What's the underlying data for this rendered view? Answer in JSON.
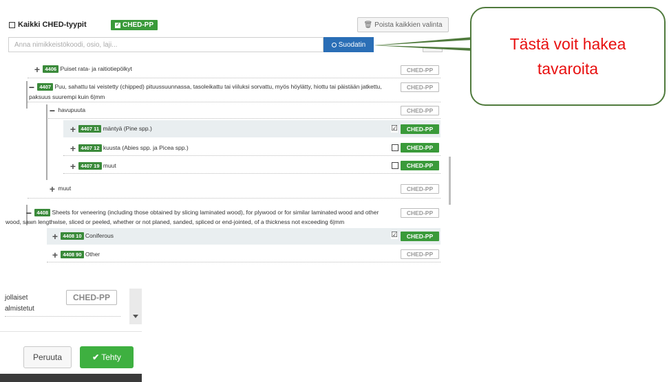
{
  "toolbar": {
    "all_types_label": "Kaikki CHED-tyypit",
    "selected_type": "CHED-PP",
    "clear_all_label": "Poista kaikkien valinta"
  },
  "search": {
    "placeholder": "Anna nimikkeistökoodi, osio, laji...",
    "filter_label": "Suodatin"
  },
  "tree": {
    "items": [
      {
        "code": "4406",
        "label": "Puiset rata- ja raitiotiepölkyt",
        "ched": "CHED-PP"
      },
      {
        "code": "4407",
        "label_line1": "Puu, sahattu tai veistetty (chipped) pituussuunnassa, tasoleikattu tai viiluksi sorvattu, myös höylätty, hiottu tai päistään jatkettu,",
        "label_line2": "paksuus suurempi kuin 6|mm",
        "ched": "CHED-PP"
      },
      {
        "code": "",
        "label": "havupuuta",
        "ched": "CHED-PP"
      },
      {
        "code": "4407 11",
        "label": "mäntyä (Pine spp.)",
        "ched": "CHED-PP",
        "checked": true
      },
      {
        "code": "4407 12",
        "label": "kuusta (Abies spp. ja Picea spp.)",
        "ched": "CHED-PP",
        "checked": false
      },
      {
        "code": "4407 19",
        "label": "muut",
        "ched": "CHED-PP",
        "checked": false
      },
      {
        "code": "",
        "label": "muut",
        "ched": "CHED-PP"
      },
      {
        "code": "4408",
        "label_line1": "Sheets for veneering (including those obtained by slicing laminated wood), for plywood or for similar laminated wood and other",
        "label_line2": "wood, sawn lengthwise, sliced or peeled, whether or not planed, sanded, spliced or end-jointed, of a thickness not exceeding 6|mm",
        "ched": "CHED-PP"
      },
      {
        "code": "4408 10",
        "label": "Coniferous",
        "ched": "CHED-PP",
        "checked": true
      },
      {
        "code": "4408 90",
        "label": "Other",
        "ched": "CHED-PP"
      }
    ]
  },
  "callout": {
    "line1": "Tästä voit hakea",
    "line2": "tavaroita"
  },
  "dialog": {
    "text1": "jollaiset",
    "text2": "almistetut",
    "ched": "CHED-PP",
    "cancel_label": "Peruuta",
    "done_label": "Tehty"
  },
  "colors": {
    "ched_green": "#3a9a3a",
    "filter_blue": "#2a6eb6",
    "callout_text": "#e81010",
    "callout_border": "#4f7a3c"
  }
}
